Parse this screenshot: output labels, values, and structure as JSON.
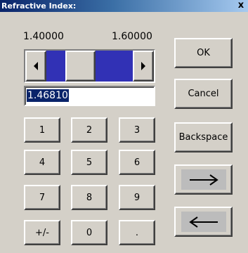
{
  "window": {
    "title": "Refractive Index:",
    "close_label": "x"
  },
  "range": {
    "min_label": "1.40000",
    "max_label": "1.60000",
    "slider_fraction": 0.34
  },
  "input": {
    "value": "1.46810",
    "selected": true
  },
  "keypad": {
    "rows": [
      [
        "1",
        "2",
        "3"
      ],
      [
        "4",
        "5",
        "6"
      ],
      [
        "7",
        "8",
        "9"
      ],
      [
        "+/-",
        "0",
        "."
      ]
    ]
  },
  "actions": {
    "ok_label": "OK",
    "cancel_label": "Cancel",
    "backspace_label": "Backspace",
    "forward_icon": "right-arrow-icon",
    "back_icon": "left-arrow-icon"
  },
  "colors": {
    "titlebar_start": "#0a246a",
    "titlebar_end": "#a6caf0",
    "face": "#d4d0c8",
    "slider_track": "#3131b5",
    "selection": "#0a246a"
  }
}
